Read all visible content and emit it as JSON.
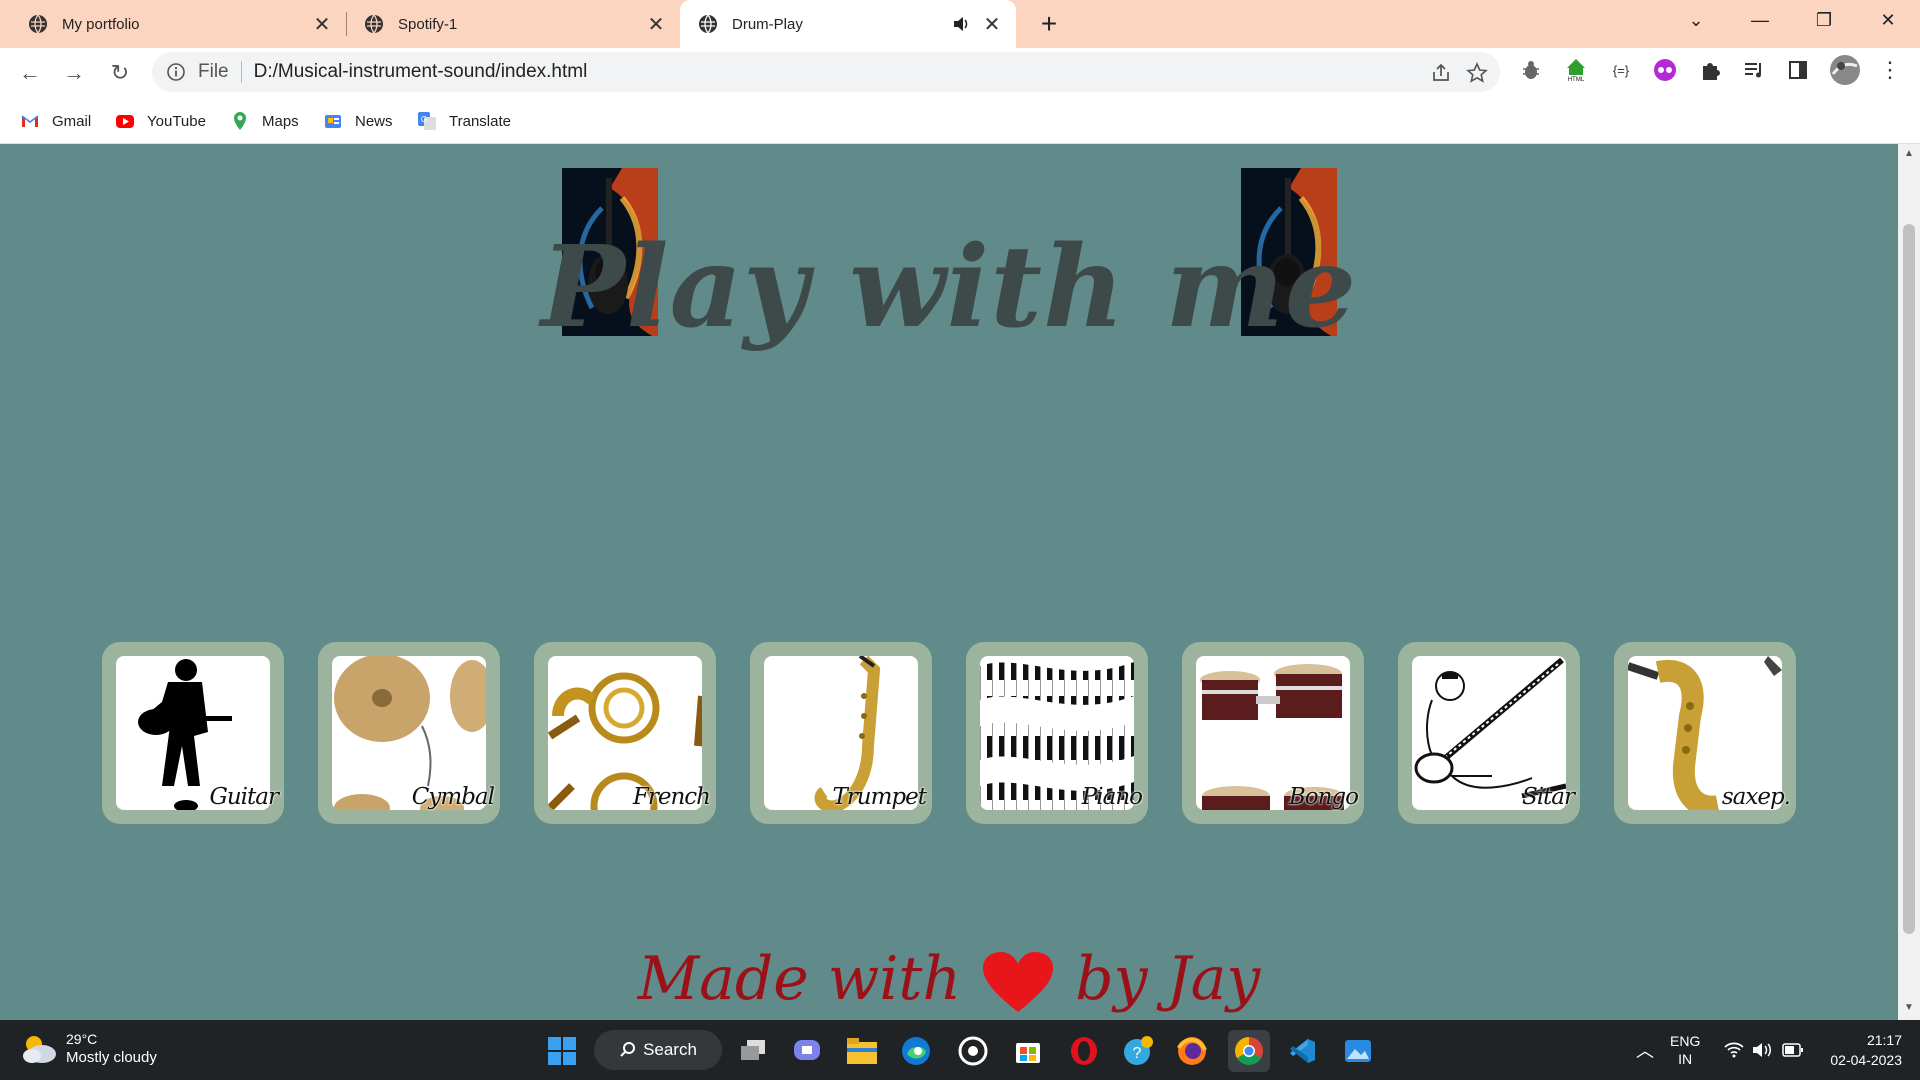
{
  "browser": {
    "tabs": [
      {
        "title": "My portfolio",
        "active": false
      },
      {
        "title": "Spotify-1",
        "active": false
      },
      {
        "title": "Drum-Play",
        "active": true,
        "audio": true
      }
    ],
    "address": {
      "scheme": "File",
      "url": "D:/Musical-instrument-sound/index.html"
    },
    "bookmarks": [
      "Gmail",
      "YouTube",
      "Maps",
      "News",
      "Translate"
    ]
  },
  "page": {
    "heading": "Play with me",
    "instruments": [
      "Guitar",
      "Cymbal",
      "French",
      "Trumpet",
      "Piano",
      "Bongo",
      "Sitar",
      "saxep."
    ],
    "footer_prefix": "Made with",
    "footer_suffix": "by Jay",
    "colors": {
      "background": "#618b8a",
      "card": "#9cb49d",
      "heading": "#3e4949",
      "footer": "#9a1218",
      "heart": "#e8151b"
    }
  },
  "taskbar": {
    "weather": {
      "temp": "29°C",
      "condition": "Mostly cloudy"
    },
    "search_label": "Search",
    "language": {
      "line1": "ENG",
      "line2": "IN"
    },
    "time": "21:17",
    "date": "02-04-2023"
  }
}
